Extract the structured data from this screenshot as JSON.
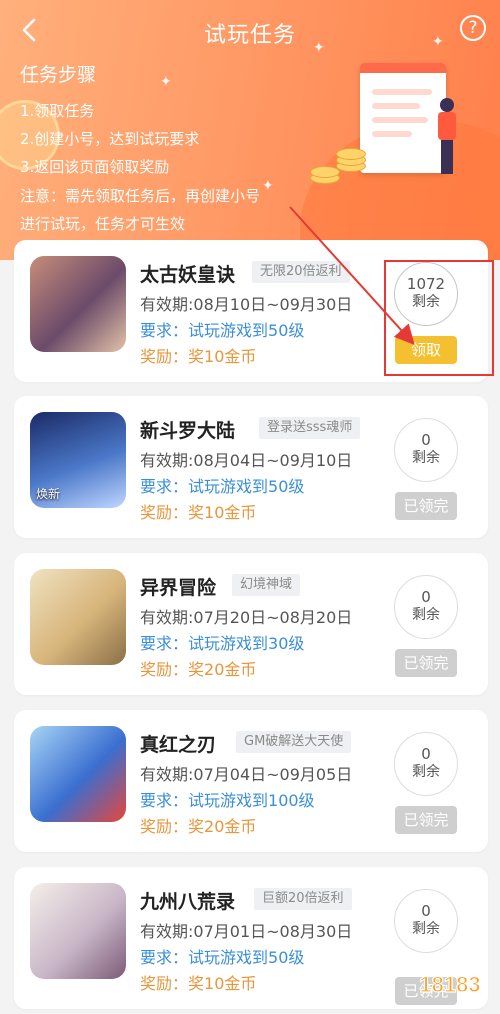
{
  "header": {
    "title": "试玩任务",
    "back_icon": "chevron-left-icon",
    "help_icon": "question-circle-icon",
    "help_glyph": "?"
  },
  "steps": {
    "title": "任务步骤",
    "items": [
      "1.领取任务",
      "2.创建小号，达到试玩要求",
      "3.返回该页面领取奖励"
    ],
    "note_line1": "注意：需先领取任务后，再创建小号",
    "note_line2": "进行试玩，任务才可生效"
  },
  "tasks": [
    {
      "name": "太古妖皇诀",
      "tag": "无限20倍返利",
      "validity_label": "有效期:",
      "validity": "08月10日~09月30日",
      "req_label": "要求：",
      "requirement": "试玩游戏到50级",
      "reward_label": "奖励：",
      "reward": "奖10金币",
      "remaining": "1072",
      "remaining_label": "剩余",
      "button": "领取",
      "thumb_text": "",
      "colors": [
        "#c78d7a",
        "#6b4b6a",
        "#e3c3a6"
      ]
    },
    {
      "name": "新斗罗大陆",
      "tag": "登录送sss魂师",
      "validity_label": "有效期:",
      "validity": "08月04日~09月10日",
      "req_label": "要求：",
      "requirement": "试玩游戏到50级",
      "reward_label": "奖励：",
      "reward": "奖10金币",
      "remaining": "0",
      "remaining_label": "剩余",
      "button": "已领完",
      "thumb_text": "焕新",
      "colors": [
        "#1b2a66",
        "#4a78c8",
        "#c0d6ff"
      ]
    },
    {
      "name": "异界冒险",
      "tag": "幻境神域",
      "validity_label": "有效期:",
      "validity": "07月20日~08月20日",
      "req_label": "要求：",
      "requirement": "试玩游戏到30级",
      "reward_label": "奖励：",
      "reward": "奖20金币",
      "remaining": "0",
      "remaining_label": "剩余",
      "button": "已领完",
      "thumb_text": "",
      "colors": [
        "#f0e2c2",
        "#d7b57a",
        "#8a6f48"
      ]
    },
    {
      "name": "真红之刃",
      "tag": "GM破解送大天使",
      "validity_label": "有效期:",
      "validity": "07月04日~09月05日",
      "req_label": "要求：",
      "requirement": "试玩游戏到100级",
      "reward_label": "奖励：",
      "reward": "奖20金币",
      "remaining": "0",
      "remaining_label": "剩余",
      "button": "已领完",
      "thumb_text": "",
      "colors": [
        "#a8d4f5",
        "#3a6fd0",
        "#e7463a"
      ]
    },
    {
      "name": "九州八荒录",
      "tag": "巨额20倍返利",
      "validity_label": "有效期:",
      "validity": "07月01日~08月30日",
      "req_label": "要求：",
      "requirement": "试玩游戏到50级",
      "reward_label": "奖励：",
      "reward": "奖10金币",
      "remaining": "0",
      "remaining_label": "剩余",
      "button": "已领完",
      "thumb_text": "",
      "colors": [
        "#f4efe9",
        "#c9b7c8",
        "#7b5b77"
      ]
    }
  ],
  "watermark": "18183",
  "colors": {
    "header_start": "#ffb07c",
    "header_end": "#ff7f4a",
    "claim": "#f4c02f",
    "done": "#cfcfcf",
    "blue_text": "#3b8fd9",
    "orange_text": "#e7963c",
    "annotation": "#e53935"
  }
}
